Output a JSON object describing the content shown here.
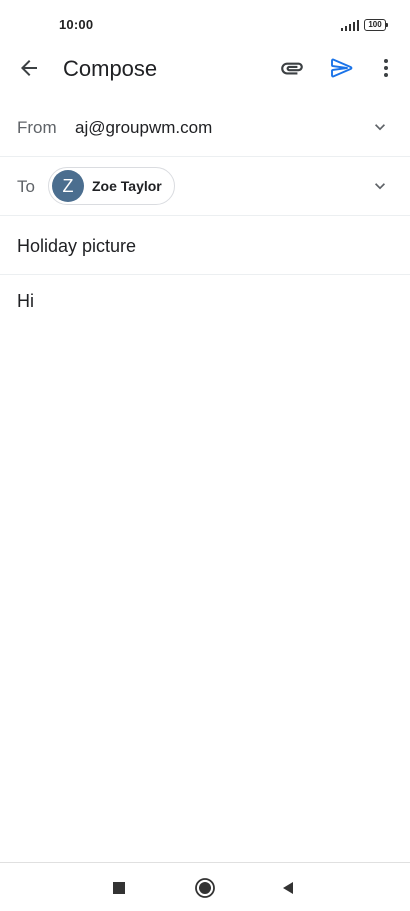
{
  "status_bar": {
    "time": "10:00",
    "battery_level": "100"
  },
  "app_bar": {
    "title": "Compose",
    "icons": {
      "back": "arrow-back-icon",
      "attach": "paperclip-icon",
      "send": "send-icon",
      "more": "more-vert-icon"
    },
    "send_color": "#1a73e8"
  },
  "from": {
    "label": "From",
    "value": "aj@groupwm.com"
  },
  "to": {
    "label": "To",
    "recipient": {
      "initial": "Z",
      "name": "Zoe Taylor",
      "avatar_color": "#4b6e8f"
    }
  },
  "subject": {
    "value": "Holiday picture"
  },
  "body": {
    "value": "Hi"
  },
  "nav_bar": {
    "icons": [
      "stop-square-icon",
      "home-circle-icon",
      "back-triangle-icon"
    ]
  }
}
